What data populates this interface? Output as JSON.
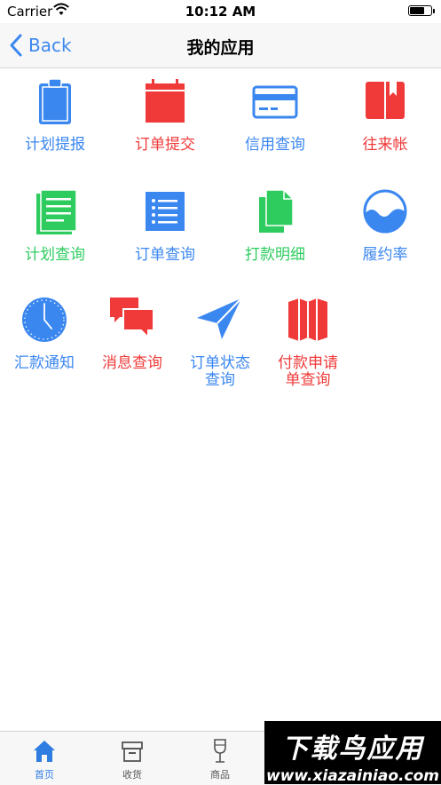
{
  "status_bar": {
    "carrier": "Carrier",
    "time": "10:12 AM"
  },
  "nav": {
    "back_label": "Back",
    "title": "我的应用"
  },
  "apps": [
    {
      "label": "计划提报",
      "color": "#3b87f0",
      "icon": "clipboard-icon"
    },
    {
      "label": "订单提交",
      "color": "#f03a3a",
      "icon": "calendar-icon"
    },
    {
      "label": "信用查询",
      "color": "#3b87f0",
      "icon": "credit-card-icon"
    },
    {
      "label": "往来帐",
      "color": "#f03a3a",
      "icon": "bookmark-book-icon"
    },
    {
      "label": "计划查询",
      "color": "#2ecc5f",
      "icon": "document-lines-icon"
    },
    {
      "label": "订单查询",
      "color": "#3b87f0",
      "icon": "list-icon"
    },
    {
      "label": "打款明细",
      "color": "#2ecc5f",
      "icon": "copy-files-icon"
    },
    {
      "label": "履约率",
      "color": "#3b87f0",
      "icon": "wave-circle-icon"
    },
    {
      "label": "汇款通知",
      "color": "#3b87f0",
      "icon": "clock-icon"
    },
    {
      "label": "消息查询",
      "color": "#f03a3a",
      "icon": "chat-bubbles-icon"
    },
    {
      "label": "订单状态\n查询",
      "color": "#3b87f0",
      "icon": "paper-plane-icon"
    },
    {
      "label": "付款申请\n单查询",
      "color": "#f03a3a",
      "icon": "map-icon"
    }
  ],
  "tabs": [
    {
      "label": "首页",
      "icon": "home-icon",
      "active": true
    },
    {
      "label": "收货",
      "icon": "archive-box-icon",
      "active": false
    },
    {
      "label": "商品",
      "icon": "wine-glass-icon",
      "active": false
    }
  ],
  "watermark": {
    "title": "下载鸟应用",
    "url": "www.xiazainiao.com"
  }
}
